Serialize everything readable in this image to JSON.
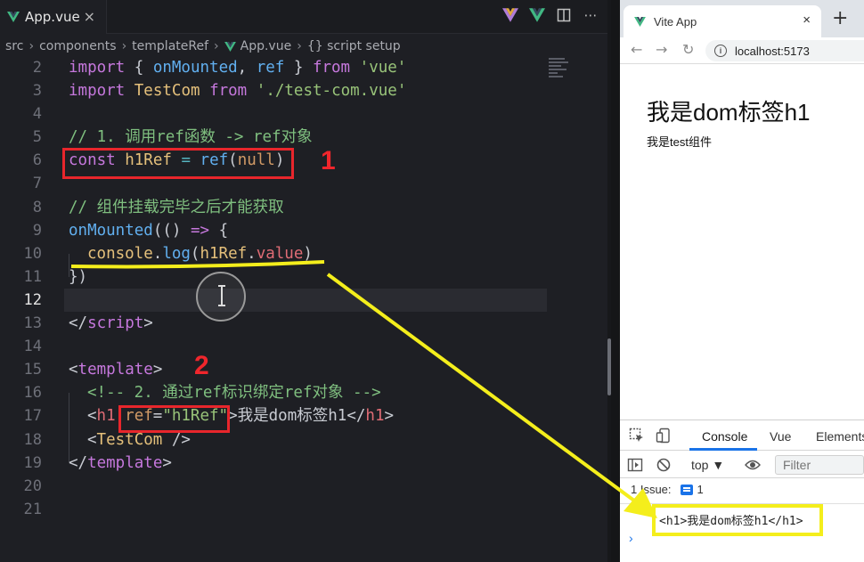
{
  "editor": {
    "tab": {
      "label": "App.vue",
      "close": "×"
    },
    "toolbar_icons": [
      "vue-devtools-icon",
      "vue-icon",
      "split-editor-icon",
      "more-actions-icon"
    ],
    "breadcrumb": [
      "src",
      "components",
      "templateRef",
      "App.vue",
      "{} script setup"
    ],
    "lines": [
      {
        "n": "2"
      },
      {
        "n": "3"
      },
      {
        "n": "4"
      },
      {
        "n": "5"
      },
      {
        "n": "6"
      },
      {
        "n": "7"
      },
      {
        "n": "8"
      },
      {
        "n": "9"
      },
      {
        "n": "10"
      },
      {
        "n": "11"
      },
      {
        "n": "12"
      },
      {
        "n": "13"
      },
      {
        "n": "14"
      },
      {
        "n": "15"
      },
      {
        "n": "16"
      },
      {
        "n": "17"
      },
      {
        "n": "18"
      },
      {
        "n": "19"
      },
      {
        "n": "20"
      },
      {
        "n": "21"
      }
    ],
    "code": {
      "l2": [
        "import",
        " { ",
        "onMounted",
        ", ",
        "ref",
        " } ",
        "from",
        " ",
        "'vue'"
      ],
      "l3": [
        "import",
        " ",
        "TestCom",
        " ",
        "from",
        " ",
        "'./test-com.vue'"
      ],
      "l5": "// 1. 调用ref函数 -> ref对象",
      "l6": [
        "const",
        " ",
        "h1Ref",
        " = ",
        "ref",
        "(",
        "null",
        ")"
      ],
      "l8": "// 组件挂载完毕之后才能获取",
      "l9": [
        "onMounted",
        "(",
        "() ",
        "=>",
        " {"
      ],
      "l10": [
        "console",
        ".",
        "log",
        "(",
        "h1Ref",
        ".",
        "value",
        ")"
      ],
      "l11": "})",
      "l13": [
        "</",
        "script",
        ">"
      ],
      "l15": [
        "<",
        "template",
        ">"
      ],
      "l16": "<!-- 2. 通过ref标识绑定ref对象 -->",
      "l17": [
        "<",
        "h1",
        " ",
        "ref",
        "=",
        "\"h1Ref\"",
        ">",
        "我是dom标签h1",
        "</",
        "h1",
        ">"
      ],
      "l18": [
        "<",
        "TestCom",
        " />"
      ],
      "l19": [
        "</",
        "template",
        ">"
      ]
    },
    "annotations": {
      "badge1": "1",
      "badge2": "2"
    }
  },
  "browser": {
    "tab": {
      "title": "Vite App",
      "close": "×",
      "new_tab": "+"
    },
    "nav": {
      "back": "←",
      "forward": "→",
      "reload": "↻"
    },
    "url": "localhost:5173",
    "page": {
      "h1": "我是dom标签h1",
      "p": "我是test组件"
    },
    "devtools": {
      "tabs": [
        "Console",
        "Vue",
        "Elements"
      ],
      "context": "top ▼",
      "filter_placeholder": "Filter",
      "issues_label": "1 Issue:",
      "issues_count": "1",
      "log": "<h1>我是dom标签h1</h1>",
      "prompt": "›"
    }
  },
  "colors": {
    "highlight_red": "#e8262c",
    "highlight_yellow": "#f4ee1c"
  }
}
